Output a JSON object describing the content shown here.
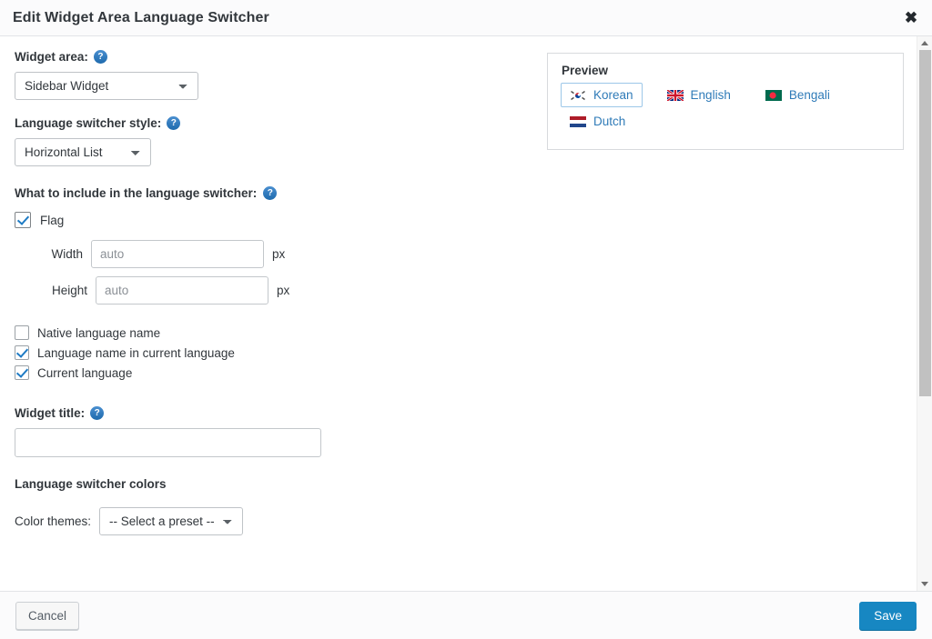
{
  "header": {
    "title": "Edit Widget Area Language Switcher",
    "close_label": "✖"
  },
  "form": {
    "widget_area": {
      "label": "Widget area:",
      "help": "?",
      "value": "Sidebar Widget",
      "options": [
        "Sidebar Widget"
      ]
    },
    "switcher_style": {
      "label": "Language switcher style:",
      "help": "?",
      "value": "Horizontal List",
      "options": [
        "Horizontal List"
      ]
    },
    "include_section": {
      "label": "What to include in the language switcher:",
      "help": "?",
      "flag": {
        "label": "Flag",
        "checked": true,
        "width": {
          "label": "Width",
          "value": "",
          "placeholder": "auto",
          "unit": "px"
        },
        "height": {
          "label": "Height",
          "value": "",
          "placeholder": "auto",
          "unit": "px"
        }
      },
      "checkboxes": [
        {
          "label": "Native language name",
          "checked": false
        },
        {
          "label": "Language name in current language",
          "checked": true
        },
        {
          "label": "Current language",
          "checked": true
        }
      ]
    },
    "widget_title": {
      "label": "Widget title:",
      "help": "?",
      "value": "",
      "placeholder": ""
    },
    "colors": {
      "heading": "Language switcher colors",
      "theme_label": "Color themes:",
      "theme_value": "-- Select a preset --",
      "theme_options": [
        "-- Select a preset --"
      ]
    }
  },
  "preview": {
    "heading": "Preview",
    "languages": [
      {
        "name": "Korean",
        "flag": "kr",
        "current": true
      },
      {
        "name": "English",
        "flag": "gb",
        "current": false
      },
      {
        "name": "Bengali",
        "flag": "bd",
        "current": false
      },
      {
        "name": "Dutch",
        "flag": "nl",
        "current": false
      }
    ]
  },
  "footer": {
    "cancel_label": "Cancel",
    "save_label": "Save"
  },
  "colors": {
    "accent": "#1787c2",
    "link": "#2f7bb8",
    "help_icon": "#2572b4",
    "checkbox_check": "#1e7bc4",
    "text": "#32373c",
    "panel_border": "#d8dadd",
    "chrome_bg": "#fbfbfc"
  }
}
